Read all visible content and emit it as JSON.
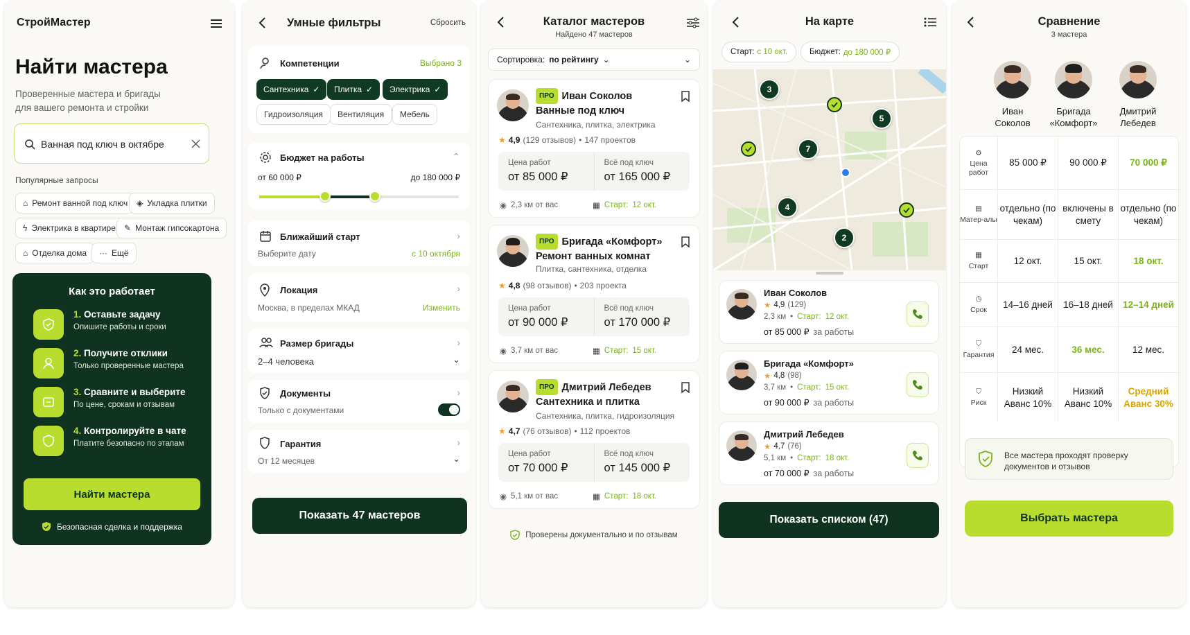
{
  "colors": {
    "primary": "#0f3320",
    "accent": "#b8dd2e",
    "accent_text": "#7ab317",
    "background": "#faf9f6"
  },
  "s1": {
    "brand": "СтройМастер",
    "title": "Найти мастера",
    "subtitle_1": "Проверенные мастера и бригады",
    "subtitle_2": "для вашего ремонта и стройки",
    "search_value": "Ванная под ключ в октябре",
    "popular_label": "Популярные запросы",
    "chips": [
      "Ремонт ванной под ключ",
      "Укладка плитки",
      "Электрика в квартире",
      "Монтаж гипсокартона",
      "Отделка дома",
      "Ещё"
    ],
    "how_title": "Как это работает",
    "steps": [
      {
        "num": "1.",
        "title": "Оставьте задачу",
        "desc": "Опишите работы и сроки"
      },
      {
        "num": "2.",
        "title": "Получите отклики",
        "desc": "Только проверенные мастера"
      },
      {
        "num": "3.",
        "title": "Сравните и выберите",
        "desc": "По цене, срокам и отзывам"
      },
      {
        "num": "4.",
        "title": "Контролируйте в чате",
        "desc": "Платите безопасно по этапам"
      }
    ],
    "cta": "Найти мастера",
    "safe": "Безопасная сделка и поддержка"
  },
  "s2": {
    "title": "Умные фильтры",
    "reset": "Сбросить",
    "comp_label": "Компетенции",
    "comp_selected": "Выбрано  3",
    "comp_on": [
      "Сантехника",
      "Плитка",
      "Электрика"
    ],
    "comp_off": [
      "Гидроизоляция",
      "Вентиляция",
      "Мебель"
    ],
    "budget_label": "Бюджет на работы",
    "budget_min": "от 60 000 ₽",
    "budget_max": "до 180 000 ₽",
    "budget_range": [
      0.33,
      0.58
    ],
    "start_label": "Ближайший старт",
    "start_hint": "Выберите дату",
    "start_value": "с  10 октября",
    "loc_label": "Локация",
    "loc_value": "Москва, в пределах МКАД",
    "loc_change": "Изменить",
    "team_label": "Размер бригады",
    "team_value": "2–4 человека",
    "docs_label": "Документы",
    "docs_value": "Только с документами",
    "warranty_label": "Гарантия",
    "warranty_value": "От 12 месяцев",
    "cta": "Показать 47 мастеров"
  },
  "s3": {
    "title": "Каталог мастеров",
    "found": "Найдено 47 мастеров",
    "sort_label": "Сортировка:",
    "sort_value": "по рейтингу",
    "price_label": "Цена работ",
    "full_label": "Всё под ключ",
    "start_prefix": "Старт:",
    "pro": "ПРО",
    "cards": [
      {
        "name": "Иван Соколов",
        "spec": "Ванные под ключ",
        "skills": "Сантехника, плитка, электрика",
        "rating": "4,9",
        "reviews": "(129 отзывов)",
        "projects": "147 проектов",
        "price": "от 85 000 ₽",
        "full": "от 165 000 ₽",
        "dist": "2,3 км от вас",
        "start": "12 окт."
      },
      {
        "name": "Бригада «Комфорт»",
        "spec": "Ремонт ванных комнат",
        "skills": "Плитка, сантехника, отделка",
        "rating": "4,8",
        "reviews": "(98 отзывов)",
        "projects": "203 проекта",
        "price": "от 90 000 ₽",
        "full": "от 170 000 ₽",
        "dist": "3,7 км от вас",
        "start": "15 окт."
      },
      {
        "name": "Дмитрий Лебедев",
        "spec": "Сантехника и плитка",
        "skills": "Сантехника, плитка, гидроизоляция",
        "rating": "4,7",
        "reviews": "(76 отзывов)",
        "projects": "112 проектов",
        "price": "от 70 000 ₽",
        "full": "от 145 000 ₽",
        "dist": "5,1 км от вас",
        "start": "18 окт."
      }
    ],
    "footer": "Проверены документально и по отзывам"
  },
  "s4": {
    "title": "На карте",
    "filter_start_label": "Старт:",
    "filter_start": "с 10 окт.",
    "filter_budget_label": "Бюджет:",
    "filter_budget": "до 180 000 ₽",
    "pins": [
      "3",
      "5",
      "7",
      "4",
      "2"
    ],
    "start_prefix": "Старт:",
    "per_work": "за работы",
    "cards": [
      {
        "name": "Иван Соколов",
        "rating": "4,9",
        "reviews": "(129)",
        "dist": "2,3 км",
        "start": "12 окт.",
        "price": "от 85 000 ₽"
      },
      {
        "name": "Бригада «Комфорт»",
        "rating": "4,8",
        "reviews": "(98)",
        "dist": "3,7 км",
        "start": "15 окт.",
        "price": "от 90 000 ₽"
      },
      {
        "name": "Дмитрий Лебедев",
        "rating": "4,7",
        "reviews": "(76)",
        "dist": "5,1 км",
        "start": "18 окт.",
        "price": "от 70 000 ₽"
      }
    ],
    "cta": "Показать списком (47)"
  },
  "s5": {
    "title": "Сравнение",
    "count": "3 мастера",
    "people": [
      {
        "l1": "Иван",
        "l2": "Соколов"
      },
      {
        "l1": "Бригада",
        "l2": "«Комфорт»"
      },
      {
        "l1": "Дмитрий",
        "l2": "Лебедев"
      }
    ],
    "rows": [
      {
        "icon": "gear-icon",
        "label": "Цена работ",
        "vals": [
          "85 000 ₽",
          "90 000 ₽",
          "70 000 ₽"
        ],
        "best": 2
      },
      {
        "icon": "materials-icon",
        "label": "Матер-алы",
        "vals": [
          "отдельно (по чекам)",
          "включены в смету",
          "отдельно (по чекам)"
        ],
        "best": -1
      },
      {
        "icon": "calendar-icon",
        "label": "Старт",
        "vals": [
          "12 окт.",
          "15 окт.",
          "18 окт."
        ],
        "best": 2
      },
      {
        "icon": "clock-icon",
        "label": "Срок",
        "vals": [
          "14–16 дней",
          "16–18 дней",
          "12–14 дней"
        ],
        "best": 2
      },
      {
        "icon": "shield-icon",
        "label": "Гарантия",
        "vals": [
          "24 мес.",
          "36 мес.",
          "12 мес."
        ],
        "best": 1
      },
      {
        "icon": "risk-icon",
        "label": "Риск",
        "vals": [
          "Низкий",
          "Низкий",
          "Средний"
        ],
        "sub": [
          "Аванс 10%",
          "Аванс 10%",
          "Аванс 30%"
        ],
        "best": 2
      }
    ],
    "notice": "Все мастера проходят проверку документов и отзывов",
    "cta": "Выбрать мастера"
  }
}
